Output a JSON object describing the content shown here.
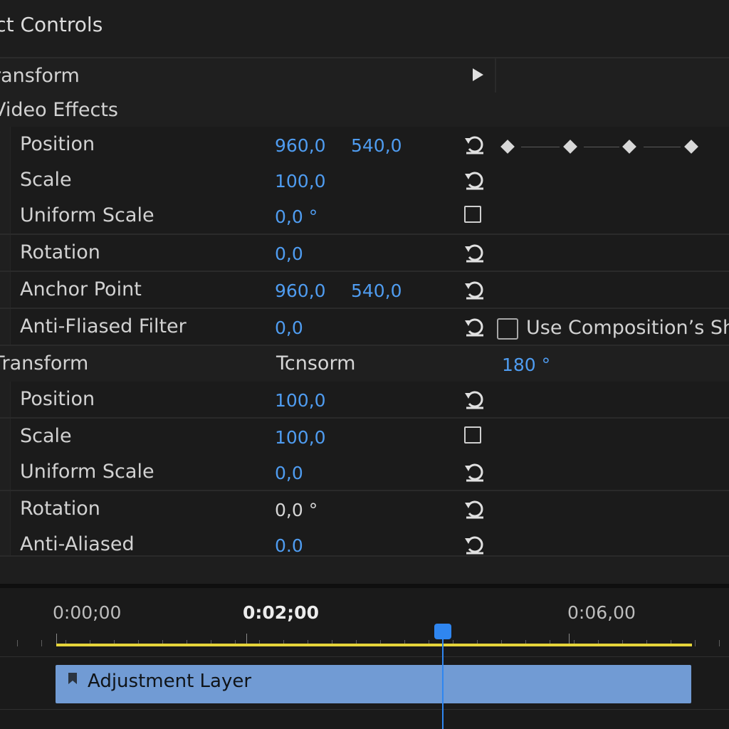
{
  "panel": {
    "title": "ect Controls"
  },
  "icons": {
    "reset": "reset-icon",
    "play": "play-triangle-icon",
    "clip": "bookmark-icon"
  },
  "colors": {
    "value": "#4f9cf0",
    "clip": "#719bd4",
    "work_area": "#e5d43a",
    "playhead": "#2f86f0"
  },
  "sections": {
    "transform_top": {
      "label": "ransform"
    },
    "video_effects": {
      "label": "Video Effects"
    },
    "transform": {
      "label": "Transform",
      "mid_text": "Tcnsorm",
      "right_value": "180 °"
    }
  },
  "properties": [
    {
      "label": "Position",
      "value1": "960,0",
      "value2": "540,0"
    },
    {
      "label": "Scale",
      "value1": "100,0"
    },
    {
      "label": "Uniform Scale",
      "value1": "0,0 °"
    },
    {
      "label": "Rotation",
      "value1": "0,0"
    },
    {
      "label": "Anchor Point",
      "value1": "960,0",
      "value2": "540,0"
    },
    {
      "label": "Anti-Fliased Filter",
      "value1": "0,0"
    },
    {
      "label": "Position",
      "value1": "100,0"
    },
    {
      "label": "Scale",
      "value1": "100,0"
    },
    {
      "label": "Uniform Scale",
      "value1": "0,0"
    },
    {
      "label": "Rotation",
      "value1": "0,0 °"
    },
    {
      "label": "Anti-Aliased",
      "value1": "0.0"
    }
  ],
  "shutter_option": {
    "label": "Use Composition’s Shut",
    "checked": false
  },
  "timeline": {
    "timecodes": [
      "0:00;00",
      "0:02;00",
      "0:06,00"
    ],
    "clip_label": "Adjustment Layer"
  }
}
